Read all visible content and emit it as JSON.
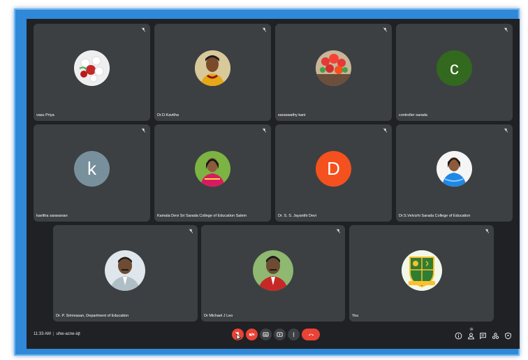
{
  "participants": [
    {
      "name": "vasu Priya",
      "avatar": "flower-photo"
    },
    {
      "name": "Dr.D.Kavitha",
      "avatar": "person-photo"
    },
    {
      "name": "saraswathy kani",
      "avatar": "flower-photo"
    },
    {
      "name": "controller sarada",
      "avatar_letter": "c",
      "avatar_color": "#33691e"
    },
    {
      "name": "kavitha saravanan",
      "avatar_letter": "k",
      "avatar_color": "#78909c"
    },
    {
      "name": "Kamala Devi Sri Sarada College of Education Salem",
      "avatar": "person-photo"
    },
    {
      "name": "Dr. S. S. Jayanthi Devi",
      "avatar_letter": "D",
      "avatar_color": "#f4511e"
    },
    {
      "name": "Dr.S.Velvizhi Sarada College of Education",
      "avatar": "person-photo"
    },
    {
      "name": "Dr. P. Srinivasan, Department of Education",
      "avatar": "person-photo"
    },
    {
      "name": "Dr Michael J Leo",
      "avatar": "person-photo"
    },
    {
      "name": "You",
      "avatar": "emblem-logo"
    }
  ],
  "bottom_bar": {
    "time": "11:33 AM",
    "separator": "|",
    "meeting_code": "uhw-acne-iqt",
    "people_count": "11"
  },
  "colors": {
    "frame": "#2f88d8",
    "background": "#202124",
    "tile": "#3c4043",
    "danger": "#ea4335"
  },
  "icons": {
    "tile_mic": "mic-off-icon",
    "controls": [
      "mic-off-icon",
      "camera-off-icon",
      "captions-icon",
      "present-icon",
      "more-options-icon",
      "end-call-icon"
    ],
    "right": [
      "info-icon",
      "people-icon",
      "chat-icon",
      "activities-icon",
      "host-controls-icon"
    ]
  }
}
